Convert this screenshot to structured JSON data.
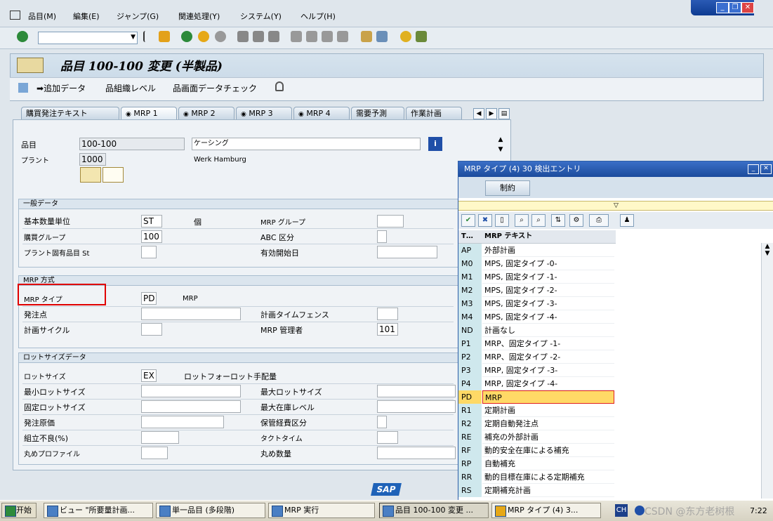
{
  "menu": [
    "品目(M)",
    "編集(E)",
    "ジャンプ(G)",
    "関連処理(Y)",
    "システム(Y)",
    "ヘルプ(H)"
  ],
  "header": {
    "title": "品目 100-100 変更 (半製品)",
    "app_buttons": [
      "追加データ",
      "組織レベル",
      "画面データチェック"
    ]
  },
  "tabs": [
    "購買発注テキスト",
    "MRP 1",
    "MRP 2",
    "MRP 3",
    "MRP 4",
    "需要予測",
    "作業計画"
  ],
  "material": {
    "material_label": "品目",
    "material_value": "100-100",
    "material_desc": "ケーシング",
    "plant_label": "プラント",
    "plant_value": "1000",
    "plant_name": "Werk Hamburg"
  },
  "general": {
    "header": "一般データ",
    "base_uom_label": "基本数量単位",
    "base_uom_value": "ST",
    "base_uom_text": "個",
    "mrp_group_label": "MRP グループ",
    "purch_group_label": "購買グループ",
    "purch_group_value": "100",
    "abc_label": "ABC 区分",
    "plant_status_label": "プラント固有品目 St",
    "valid_from_label": "有効開始日"
  },
  "mrp_procedure": {
    "header": "MRP 方式",
    "mrp_type_label": "MRP タイプ",
    "mrp_type_value": "PD",
    "mrp_type_text": "MRP",
    "reorder_point_label": "発注点",
    "time_fence_label": "計画タイムフェンス",
    "planning_cycle_label": "計画サイクル",
    "controller_label": "MRP 管理者",
    "controller_value": "101"
  },
  "lot_size": {
    "header": "ロットサイズデータ",
    "lot_size_label": "ロットサイズ",
    "lot_size_value": "EX",
    "lot_size_text": "ロットフォーロット手配量",
    "min_lot_label": "最小ロットサイズ",
    "max_lot_label": "最大ロットサイズ",
    "fixed_lot_label": "固定ロットサイズ",
    "max_stock_label": "最大在庫レベル",
    "order_cost_label": "発注原価",
    "storage_cost_label": "保管経費区分",
    "scrap_label": "組立不良(%)",
    "takt_label": "タクトタイム",
    "rounding_profile_label": "丸めプロファイル",
    "rounding_value_label": "丸め数量"
  },
  "popup": {
    "title": "MRP タイプ (4)   30 検出エントリ",
    "tab": "制約",
    "col_code": "T…",
    "col_text": "MRP テキスト",
    "rows": [
      {
        "code": "AP",
        "text": "外部計画"
      },
      {
        "code": "M0",
        "text": "MPS, 固定タイプ -0-"
      },
      {
        "code": "M1",
        "text": "MPS, 固定タイプ -1-"
      },
      {
        "code": "M2",
        "text": "MPS, 固定タイプ -2-"
      },
      {
        "code": "M3",
        "text": "MPS, 固定タイプ -3-"
      },
      {
        "code": "M4",
        "text": "MPS, 固定タイプ -4-"
      },
      {
        "code": "ND",
        "text": "計画なし"
      },
      {
        "code": "P1",
        "text": "MRP、固定タイプ -1-"
      },
      {
        "code": "P2",
        "text": "MRP、固定タイプ -2-"
      },
      {
        "code": "P3",
        "text": "MRP, 固定タイプ -3-"
      },
      {
        "code": "P4",
        "text": "MRP, 固定タイプ -4-"
      },
      {
        "code": "PD",
        "text": "MRP",
        "selected": true
      },
      {
        "code": "R1",
        "text": "定期計画"
      },
      {
        "code": "R2",
        "text": "定期自動発注点"
      },
      {
        "code": "RE",
        "text": "補充の外部計画"
      },
      {
        "code": "RF",
        "text": "動的安全在庫による補充"
      },
      {
        "code": "RP",
        "text": "自動補充"
      },
      {
        "code": "RR",
        "text": "動的目標在庫による定期補充"
      },
      {
        "code": "RS",
        "text": "定期補充計画"
      }
    ]
  },
  "sap_logo": "SAP",
  "taskbar": {
    "start": "开始",
    "tasks": [
      "ビュー \"所要量計画...",
      "単一品目 (多段階)",
      "MRP 実行",
      "品目 100-100 変更 ...",
      "MRP タイプ (4)  3..."
    ],
    "lang": "CH",
    "watermark": "CSDN @东方老树根",
    "clock": "7:22"
  },
  "colors": {
    "accent": "#1c4b9c",
    "selected_row": "#ffd966",
    "highlight_box": "#e00000"
  }
}
